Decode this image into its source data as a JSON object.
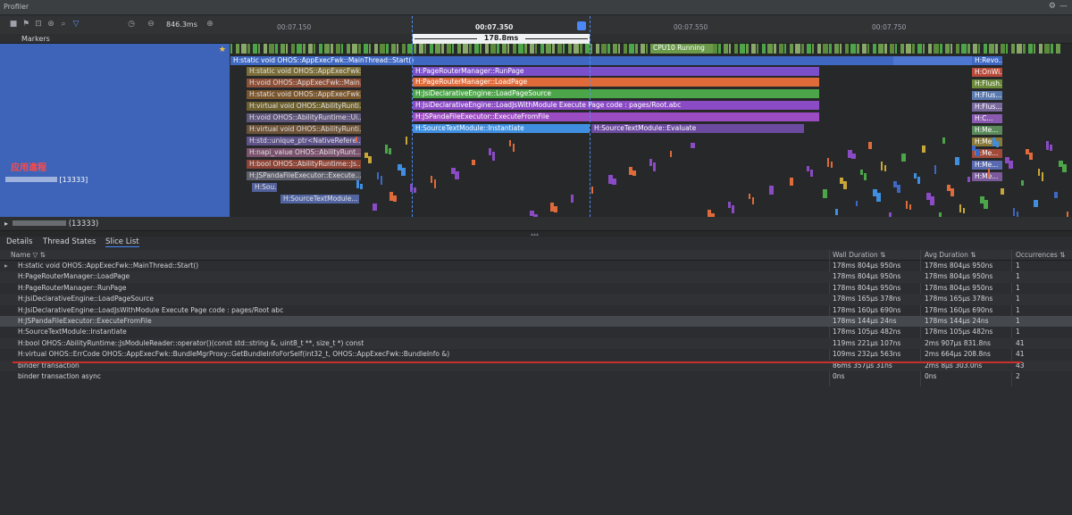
{
  "window": {
    "title": "Profiler"
  },
  "toolbar": {
    "duration": "846.3ms"
  },
  "ruler": {
    "ticks": [
      "00:07.150",
      "00:07.350",
      "00:07.550",
      "00:07.750"
    ],
    "selected_tick": "00:07.350"
  },
  "markers": {
    "label": "Markers"
  },
  "selection": {
    "duration": "178.8ms"
  },
  "process": {
    "annotation": "应用進程",
    "pid_label": "[13333]",
    "row_label": "(13333)"
  },
  "timeline": {
    "main_row": "H:static void OHOS::AppExecFwk::MainThread::Start()",
    "cpu_running": "CPU10 Running",
    "slices": {
      "run_page": "H:PageRouterManager::RunPage",
      "load_page": "H:PageRouterManager::LoadPage",
      "load_page_source": "H:JsiDeclarativeEngine::LoadPageSource",
      "load_js": "H:JsiDeclarativeEngine::LoadJsWithModule Execute Page code : pages/Root.abc",
      "execute_file": "H:JSPandaFileExecutor::ExecuteFromFile",
      "instantiate": "H:SourceTextModule::Instantiate",
      "evaluate": "H:SourceTextModule::Evaluate"
    },
    "left_slices": [
      "H:static void OHOS::AppExecFwk::Mai...",
      "H:void OHOS::AppExecFwk::Main...",
      "H:static void OHOS::AppExecFwk...",
      "H:virtual void OHOS::AbilityRunti...",
      "H:void OHOS::AbilityRuntime::Ui...",
      "H:virtual void OHOS::AbilityRunti...",
      "H:std::unique_ptr<NativeRefere...",
      "H:napi_value OHOS::AbilityRunt...",
      "H:bool OHOS::AbilityRuntime::Js...",
      "H:JSPandaFileExecutor::Execute...",
      "H:Sou...",
      "H:SourceTextModule..."
    ],
    "right_slices": [
      "H:Revo...",
      "H:OnWi...",
      "H:Flush...",
      "H:Flus...",
      "H:Flus...",
      "H:C...",
      "H:Me...",
      "H:Me...",
      "H:Me...",
      "H:Me...",
      "H:Me..."
    ]
  },
  "details": {
    "tabs": [
      "Details",
      "Thread States",
      "Slice List"
    ],
    "active_tab": "Slice List",
    "columns": [
      "Name",
      "Wall Duration",
      "Avg Duration",
      "Occurrences"
    ],
    "rows": [
      {
        "name": "H:static void OHOS::AppExecFwk::MainThread::Start()",
        "wall": "178ms 804μs 950ns",
        "avg": "178ms 804μs 950ns",
        "occ": "1"
      },
      {
        "name": "H:PageRouterManager::LoadPage",
        "wall": "178ms 804μs 950ns",
        "avg": "178ms 804μs 950ns",
        "occ": "1"
      },
      {
        "name": "H:PageRouterManager::RunPage",
        "wall": "178ms 804μs 950ns",
        "avg": "178ms 804μs 950ns",
        "occ": "1"
      },
      {
        "name": "H:JsiDeclarativeEngine::LoadPageSource",
        "wall": "178ms 165μs 378ns",
        "avg": "178ms 165μs 378ns",
        "occ": "1"
      },
      {
        "name": "H:JsiDeclarativeEngine::LoadJsWithModule Execute Page code : pages/Root abc",
        "wall": "178ms 160μs 690ns",
        "avg": "178ms 160μs 690ns",
        "occ": "1"
      },
      {
        "name": "H:JSPandaFileExecutor::ExecuteFromFile",
        "wall": "178ms 144μs 24ns",
        "avg": "178ms 144μs 24ns",
        "occ": "1"
      },
      {
        "name": "H:SourceTextModule::Instantiate",
        "wall": "178ms 105μs 482ns",
        "avg": "178ms 105μs 482ns",
        "occ": "1"
      },
      {
        "name": "H:bool OHOS::AbilityRuntime::JsModuleReader::operator()(const std::string &, uint8_t **, size_t *) const",
        "wall": "119ms 221μs 107ns",
        "avg": "2ms 907μs 831.8ns",
        "occ": "41"
      },
      {
        "name": "H:virtual OHOS::ErrCode OHOS::AppExecFwk::BundleMgrProxy::GetBundleInfoForSelf(int32_t, OHOS::AppExecFwk::BundleInfo &)",
        "wall": "109ms 232μs 563ns",
        "avg": "2ms 664μs 208.8ns",
        "occ": "41"
      },
      {
        "name": "binder transaction",
        "wall": "86ms 357μs 31ns",
        "avg": "2ms 8μs 303.0ns",
        "occ": "43"
      },
      {
        "name": "binder transaction async",
        "wall": "0ns",
        "avg": "0ns",
        "occ": "2"
      }
    ]
  },
  "colors": {
    "selection": "#3d64b8",
    "accent": "#4a88f7",
    "highlight_line": "#c8302b"
  }
}
